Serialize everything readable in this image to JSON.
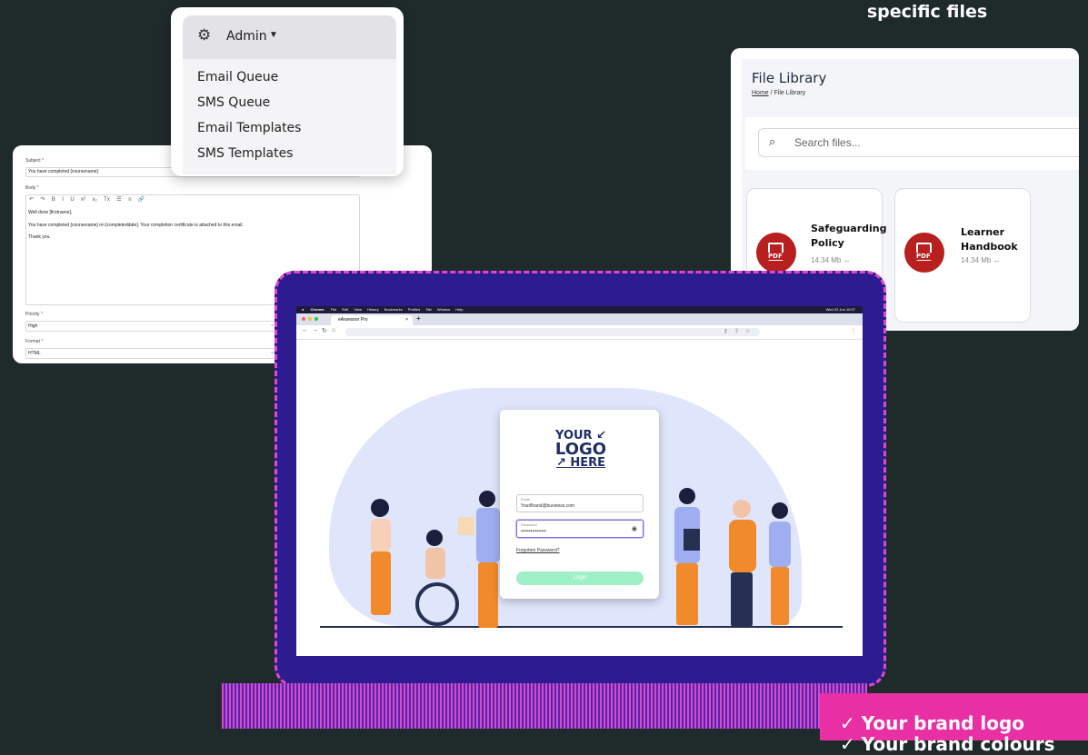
{
  "headline": "specific files",
  "admin_menu": {
    "title": "Admin",
    "items": [
      "Email Queue",
      "SMS Queue",
      "Email Templates",
      "SMS Templates"
    ]
  },
  "email_template": {
    "subject_label": "Subject",
    "subject_value": "You have completed [coursename]",
    "body_label": "Body",
    "toolbar": [
      "↶",
      "↷",
      "B",
      "I",
      "U",
      "x²",
      "x₂",
      "Tx",
      "☰",
      "≡",
      "🔗"
    ],
    "body_lines": [
      "Well done [firstname],",
      "You have completed [coursename] on [completeddate]. Your completion certificate is attached to this email.",
      "Thank you."
    ],
    "priority_label": "Priority",
    "priority_value": "High",
    "format_label": "Format",
    "format_value": "HTML",
    "required_mark": "*"
  },
  "file_library": {
    "title": "File Library",
    "breadcrumb_home": "Home",
    "breadcrumb_sep": "/",
    "breadcrumb_current": "File Library",
    "search_placeholder": "Search files...",
    "files": [
      {
        "name_line1": "Safeguarding",
        "name_line2": "Policy",
        "size": "14.34 Mb",
        "type": "PDF"
      },
      {
        "name_line1": "Learner",
        "name_line2": "Handbook",
        "size": "14.34 Mb",
        "type": "PDF"
      }
    ]
  },
  "browser": {
    "app_name": "Chrome",
    "menu_items": [
      "File",
      "Edit",
      "View",
      "History",
      "Bookmarks",
      "Profiles",
      "Tab",
      "Window",
      "Help"
    ],
    "clock": "Wed 22 Jun 10:37",
    "tab_title": "eAssessor Pro",
    "new_tab": "+"
  },
  "login": {
    "logo_line1": "YOUR ↙",
    "logo_line2": "LOGO",
    "logo_line3": "↗ HERE",
    "email_label": "Email",
    "email_value": "YourBrand@business.com",
    "password_label": "Password",
    "password_value": "••••••••••••••••",
    "forgot": "Forgotten Password?",
    "button": "Login"
  },
  "feature_box": {
    "line1": "✓ Your brand logo",
    "line2": "✓ Your brand colours"
  },
  "colors": {
    "background": "#1f2a2b",
    "laptop": "#2c1c8f",
    "accent_pink": "#e92fa4",
    "pdf_red": "#b81f1f",
    "login_green": "#9ef0c6"
  }
}
